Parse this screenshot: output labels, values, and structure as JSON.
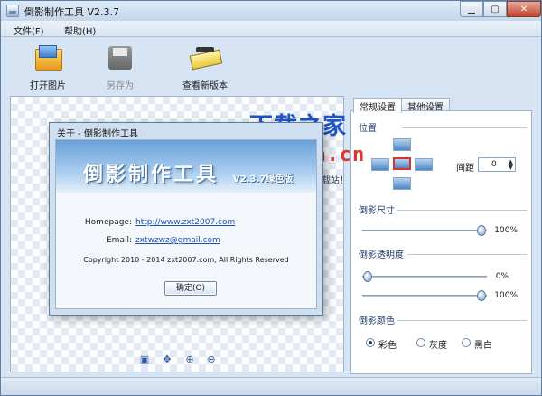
{
  "window": {
    "title": "倒影制作工具 V2.3.7"
  },
  "menu": [
    "文件(F)",
    "帮助(H)"
  ],
  "toolbar": {
    "open_label": "打开图片",
    "save_label": "另存为",
    "update_label": "查看新版本"
  },
  "dialog": {
    "title": "关于 - 倒影制作工具",
    "banner_title": "倒影制作工具",
    "banner_version": "V2.3.7绿色版",
    "homepage_label": "Homepage:",
    "homepage_value": "http://www.zxt2007.com",
    "email_label": "Email:",
    "email_value": "zxtwzwz@gmail.com",
    "copyright": "Copyright 2010 - 2014 zxt2007.com, All Rights Reserved",
    "ok_label": "确定(O)"
  },
  "panel": {
    "tabs": [
      "常规设置",
      "其他设置"
    ],
    "position_title": "位置",
    "spacing_label": "间距",
    "spacing_value": "0",
    "size_title": "倒影尺寸",
    "size_value": "100%",
    "size_level": 100,
    "opacity_title": "倒影透明度",
    "opacity_start_value": "0%",
    "opacity_start_level": 0,
    "opacity_end_value": "100%",
    "opacity_end_level": 100,
    "color_title": "倒影颜色",
    "color_options": [
      "彩色",
      "灰度",
      "黑白"
    ],
    "color_selected": "彩色"
  },
  "watermark": {
    "cn": "下载之家",
    "en": "downza.cn",
    "sub": "国内最专业的资源下载站！"
  },
  "colors": {
    "accent_blue": "#1d56c9",
    "watermark_red": "#e0332b",
    "selected_border": "#d8352a"
  }
}
